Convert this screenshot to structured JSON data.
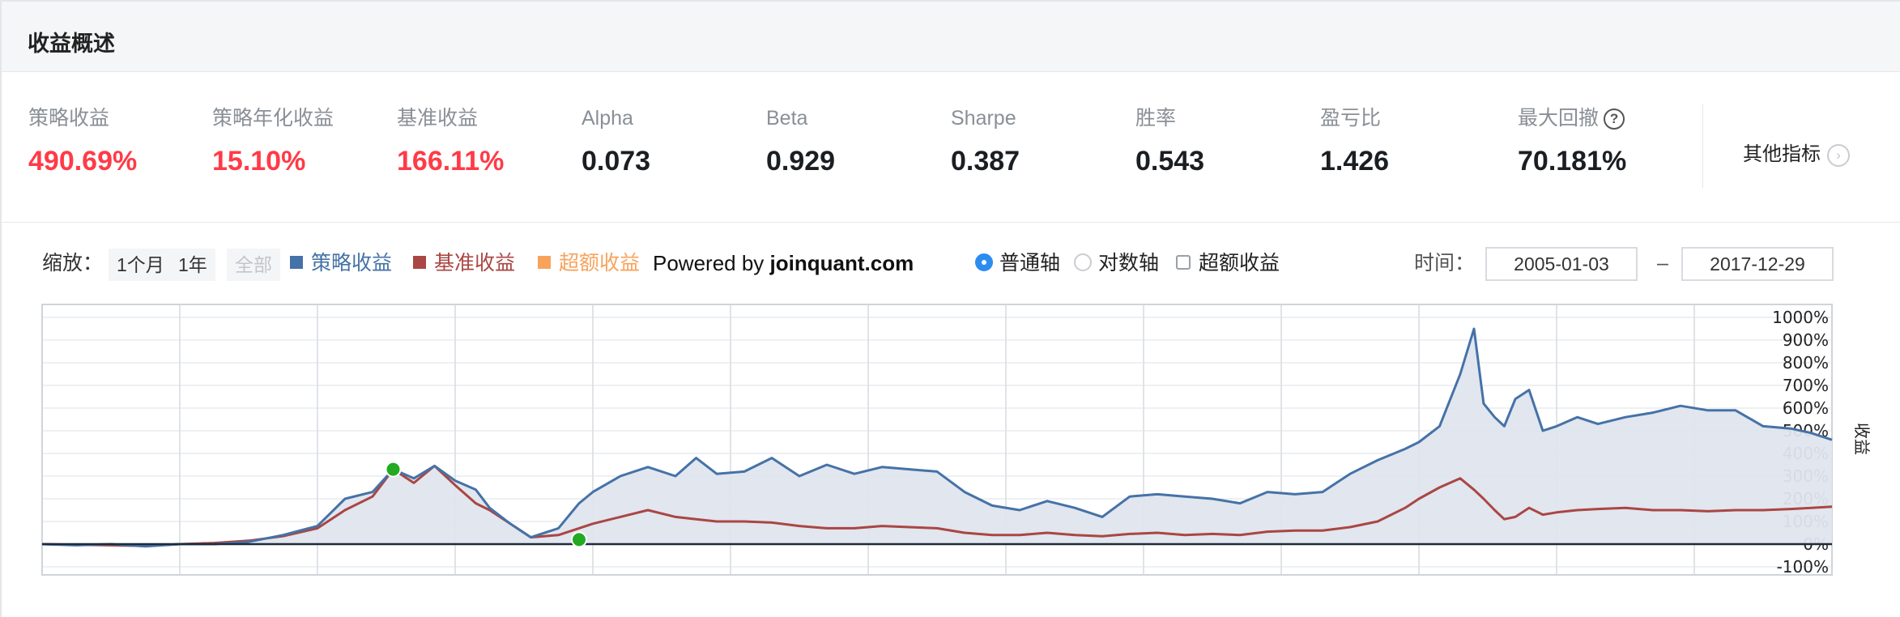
{
  "header": {
    "title": "收益概述"
  },
  "metrics": [
    {
      "label": "策略收益",
      "value": "490.69%",
      "tone": "red"
    },
    {
      "label": "策略年化收益",
      "value": "15.10%",
      "tone": "red"
    },
    {
      "label": "基准收益",
      "value": "166.11%",
      "tone": "red"
    },
    {
      "label": "Alpha",
      "value": "0.073",
      "tone": "black"
    },
    {
      "label": "Beta",
      "value": "0.929",
      "tone": "black"
    },
    {
      "label": "Sharpe",
      "value": "0.387",
      "tone": "black"
    },
    {
      "label": "胜率",
      "value": "0.543",
      "tone": "black"
    },
    {
      "label": "盈亏比",
      "value": "1.426",
      "tone": "black"
    },
    {
      "label": "最大回撤",
      "value": "70.181%",
      "tone": "black",
      "help_icon": "question-circle-icon"
    }
  ],
  "other_metrics": {
    "label": "其他指标",
    "icon": "chevron-right-icon"
  },
  "controls": {
    "zoom_label": "缩放：",
    "zoom_options": [
      {
        "label": "1个月",
        "disabled": false
      },
      {
        "label": "1年",
        "disabled": false
      },
      {
        "label": "全部",
        "disabled": true
      }
    ],
    "legend": [
      {
        "label": "策略收益",
        "color": "#4572a7"
      },
      {
        "label": "基准收益",
        "color": "#aa4643"
      },
      {
        "label": "超额收益",
        "color": "#f7a35c"
      }
    ],
    "powered_prefix": "Powered by ",
    "powered_site": "joinquant.com",
    "axis_modes": [
      {
        "label": "普通轴",
        "selected": true
      },
      {
        "label": "对数轴",
        "selected": false
      }
    ],
    "excess_toggle": {
      "label": "超额收益",
      "checked": false
    },
    "time_label": "时间：",
    "date_from": "2005-01-03",
    "date_to": "2017-12-29",
    "date_sep": "–"
  },
  "colors": {
    "strategy": "#4572a7",
    "benchmark": "#aa4643",
    "excess": "#f7a35c",
    "area_fill": "#dfe5ee",
    "marker": "#22aa22",
    "positive": "#ff3b47"
  },
  "chart_data": {
    "type": "line",
    "ylabel": "收益",
    "y_unit": "%",
    "y_ticks": [
      "1000%",
      "900%",
      "800%",
      "700%",
      "600%",
      "500%",
      "400%",
      "300%",
      "200%",
      "100%",
      "0%",
      "-100%"
    ],
    "ylim": [
      -100,
      1000
    ],
    "xlim": [
      2005.0,
      2018.0
    ],
    "grid": true,
    "legend_position": "top",
    "x": [
      2005.0,
      2005.25,
      2005.5,
      2005.75,
      2006.0,
      2006.25,
      2006.5,
      2006.75,
      2007.0,
      2007.2,
      2007.4,
      2007.55,
      2007.7,
      2007.85,
      2008.0,
      2008.15,
      2008.25,
      2008.4,
      2008.55,
      2008.75,
      2008.9,
      2009.0,
      2009.2,
      2009.4,
      2009.6,
      2009.75,
      2009.9,
      2010.1,
      2010.3,
      2010.5,
      2010.7,
      2010.9,
      2011.1,
      2011.3,
      2011.5,
      2011.7,
      2011.9,
      2012.1,
      2012.3,
      2012.5,
      2012.7,
      2012.9,
      2013.1,
      2013.3,
      2013.5,
      2013.7,
      2013.9,
      2014.1,
      2014.3,
      2014.5,
      2014.7,
      2014.9,
      2015.0,
      2015.15,
      2015.3,
      2015.4,
      2015.47,
      2015.55,
      2015.62,
      2015.7,
      2015.8,
      2015.9,
      2016.0,
      2016.15,
      2016.3,
      2016.5,
      2016.7,
      2016.9,
      2017.1,
      2017.3,
      2017.5,
      2017.7,
      2017.85,
      2018.0
    ],
    "series": [
      {
        "name": "策略收益",
        "values": [
          0,
          -5,
          0,
          -10,
          0,
          0,
          10,
          40,
          80,
          200,
          230,
          330,
          290,
          345,
          280,
          240,
          160,
          90,
          30,
          70,
          180,
          230,
          300,
          340,
          300,
          380,
          310,
          320,
          380,
          300,
          350,
          310,
          340,
          330,
          320,
          230,
          170,
          150,
          190,
          160,
          120,
          210,
          220,
          210,
          200,
          180,
          230,
          220,
          230,
          310,
          370,
          420,
          450,
          520,
          750,
          950,
          620,
          560,
          520,
          640,
          680,
          500,
          520,
          560,
          530,
          560,
          580,
          610,
          590,
          590,
          520,
          510,
          490,
          460
        ],
        "color": "#4572a7"
      },
      {
        "name": "基准收益",
        "values": [
          0,
          -3,
          -5,
          -8,
          0,
          5,
          15,
          35,
          70,
          150,
          210,
          330,
          270,
          345,
          260,
          180,
          150,
          90,
          30,
          40,
          70,
          90,
          120,
          150,
          120,
          110,
          100,
          100,
          95,
          80,
          70,
          70,
          80,
          75,
          70,
          50,
          40,
          40,
          50,
          40,
          35,
          45,
          50,
          40,
          45,
          40,
          55,
          60,
          60,
          75,
          100,
          160,
          200,
          250,
          290,
          240,
          200,
          150,
          110,
          120,
          160,
          130,
          140,
          150,
          155,
          160,
          150,
          150,
          145,
          150,
          150,
          155,
          160,
          165
        ],
        "color": "#aa4643"
      }
    ],
    "markers": [
      {
        "series": "策略收益",
        "x": 2007.55,
        "y": 330,
        "note": "max drawdown start"
      },
      {
        "series": "策略收益",
        "x": 2008.9,
        "y": 20,
        "note": "max drawdown end"
      }
    ]
  }
}
